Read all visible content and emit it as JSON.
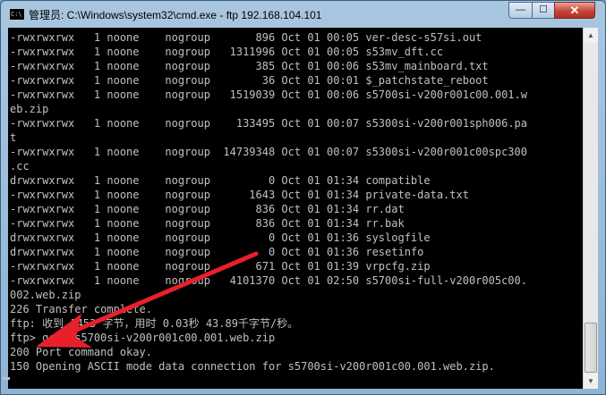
{
  "window": {
    "title": "管理员: C:\\Windows\\system32\\cmd.exe - ftp  192.168.104.101",
    "icon_label": "C:\\",
    "min_glyph": "—",
    "max_glyph": "☐",
    "close_glyph": "✕"
  },
  "console": {
    "text_color": "#c0c0c0",
    "background": "#000000",
    "lines": [
      "-rwxrwxrwx   1 noone    nogroup       896 Oct 01 00:05 ver-desc-s57si.out",
      "-rwxrwxrwx   1 noone    nogroup   1311996 Oct 01 00:05 s53mv_dft.cc",
      "-rwxrwxrwx   1 noone    nogroup       385 Oct 01 00:06 s53mv_mainboard.txt",
      "-rwxrwxrwx   1 noone    nogroup        36 Oct 01 00:01 $_patchstate_reboot",
      "-rwxrwxrwx   1 noone    nogroup   1519039 Oct 01 00:06 s5700si-v200r001c00.001.w",
      "eb.zip",
      "-rwxrwxrwx   1 noone    nogroup    133495 Oct 01 00:07 s5300si-v200r001sph006.pa",
      "t",
      "-rwxrwxrwx   1 noone    nogroup  14739348 Oct 01 00:07 s5300si-v200r001c00spc300",
      ".cc",
      "drwxrwxrwx   1 noone    nogroup         0 Oct 01 01:34 compatible",
      "-rwxrwxrwx   1 noone    nogroup      1643 Oct 01 01:34 private-data.txt",
      "-rwxrwxrwx   1 noone    nogroup       836 Oct 01 01:34 rr.dat",
      "-rwxrwxrwx   1 noone    nogroup       836 Oct 01 01:34 rr.bak",
      "drwxrwxrwx   1 noone    nogroup         0 Oct 01 01:36 syslogfile",
      "drwxrwxrwx   1 noone    nogroup         0 Oct 01 01:36 resetinfo",
      "-rwxrwxrwx   1 noone    nogroup       671 Oct 01 01:39 vrpcfg.zip",
      "-rwxrwxrwx   1 noone    nogroup   4101370 Oct 01 02:50 s5700si-full-v200r005c00.",
      "002.web.zip",
      "226 Transfer complete.",
      "ftp: 收到 1453 字节，用时 0.03秒 43.89千字节/秒。",
      "ftp> get  s5700si-v200r001c00.001.web.zip",
      "200 Port command okay.",
      "150 Opening ASCII mode data connection for s5700si-v200r001c00.001.web.zip."
    ]
  },
  "annotation": {
    "arrow_color": "#e8202a"
  }
}
